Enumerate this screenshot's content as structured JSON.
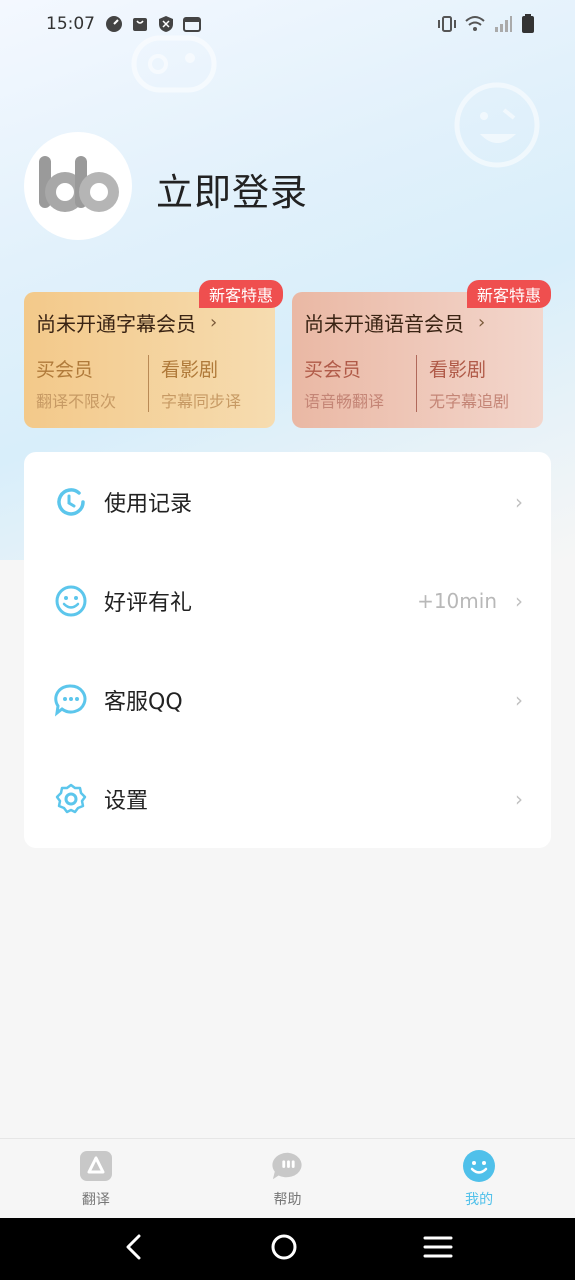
{
  "status_bar": {
    "time": "15:07"
  },
  "profile": {
    "login_label": "立即登录"
  },
  "vip_cards": [
    {
      "badge": "新客特惠",
      "title": "尚未开通字幕会员",
      "chevron": "›",
      "left_big": "买会员",
      "left_small": "翻译不限次",
      "right_big": "看影剧",
      "right_small": "字幕同步译"
    },
    {
      "badge": "新客特惠",
      "title": "尚未开通语音会员",
      "chevron": "›",
      "left_big": "买会员",
      "left_small": "语音畅翻译",
      "right_big": "看影剧",
      "right_small": "无字幕追剧"
    }
  ],
  "menu": {
    "items": [
      {
        "label": "使用记录",
        "extra": "",
        "icon": "history-icon",
        "chevron": "›"
      },
      {
        "label": "好评有礼",
        "extra": "+10min",
        "icon": "smile-icon",
        "chevron": "›"
      },
      {
        "label": "客服QQ",
        "extra": "",
        "icon": "chat-bubble-icon",
        "chevron": "›"
      },
      {
        "label": "设置",
        "extra": "",
        "icon": "settings-gear-icon",
        "chevron": "›"
      }
    ]
  },
  "tabs": [
    {
      "label": "翻译",
      "icon": "translate-icon",
      "active": false
    },
    {
      "label": "帮助",
      "icon": "help-chat-icon",
      "active": false
    },
    {
      "label": "我的",
      "icon": "profile-face-icon",
      "active": true
    }
  ],
  "colors": {
    "accent": "#4fc0ea",
    "badge": "#ef4f4f",
    "subtitle_card": "#f3c98a",
    "voice_card": "#eab8a4"
  }
}
